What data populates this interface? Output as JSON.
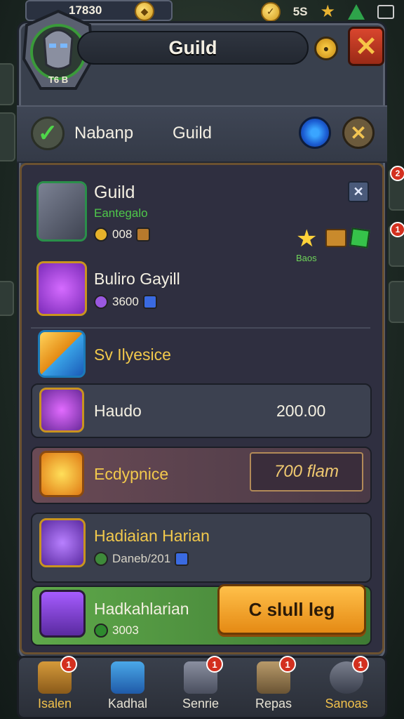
{
  "topbar": {
    "resource_value": "17830",
    "right_label": "5S"
  },
  "header": {
    "emblem_text": "T6 B",
    "title": "Guild"
  },
  "subbar": {
    "label_left": "Nabanp",
    "label_right": "Guild"
  },
  "items": [
    {
      "name": "Guild",
      "subtitle": "Eantegalo",
      "value": "008",
      "icon": "helmet-icon"
    },
    {
      "name": "Bulirо Gayill",
      "value": "3600",
      "icon": "purple-gem-icon"
    },
    {
      "name": "Sv Ilyesice",
      "icon": "cube-icon"
    },
    {
      "name": "Haudo",
      "price": "200.00",
      "icon": "feather-crystal-icon"
    },
    {
      "name": "Ecdypnice",
      "price": "700 flam",
      "icon": "fire-crystal-icon"
    },
    {
      "name": "Hadiaian Harian",
      "subtitle": "Daneb/201",
      "icon": "amethyst-icon"
    },
    {
      "name": "Hadkahlarian",
      "value": "3003",
      "icon": "chest-icon"
    }
  ],
  "badges": {
    "label": "Baos"
  },
  "cta": {
    "label": "C slull leg"
  },
  "nav": [
    {
      "label": "Isalen",
      "badge": "1",
      "gold": true
    },
    {
      "label": "Kadhal",
      "badge": "",
      "gold": false
    },
    {
      "label": "Senrie",
      "badge": "1",
      "gold": false
    },
    {
      "label": "Repas",
      "badge": "1",
      "gold": false
    },
    {
      "label": "Sanoas",
      "badge": "1",
      "gold": true
    }
  ],
  "side_badges": [
    "2",
    "1"
  ],
  "colors": {
    "panel": "#39404d",
    "accent_gold": "#f2c94c",
    "cta": "#ffc04a",
    "green_row": "#5fa84a",
    "badge_red": "#d3301f"
  }
}
